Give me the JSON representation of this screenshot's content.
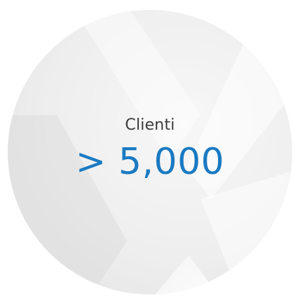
{
  "stat_card": {
    "caption": "Clienti",
    "value": "> 5,000"
  },
  "colors": {
    "value_text": "#1a7ac2",
    "caption_text": "#3a3a3a",
    "circle_background": "#eeeeee",
    "watermark": "#ffffff"
  },
  "icons": {
    "watermark": "x-logo-watermark-icon"
  }
}
